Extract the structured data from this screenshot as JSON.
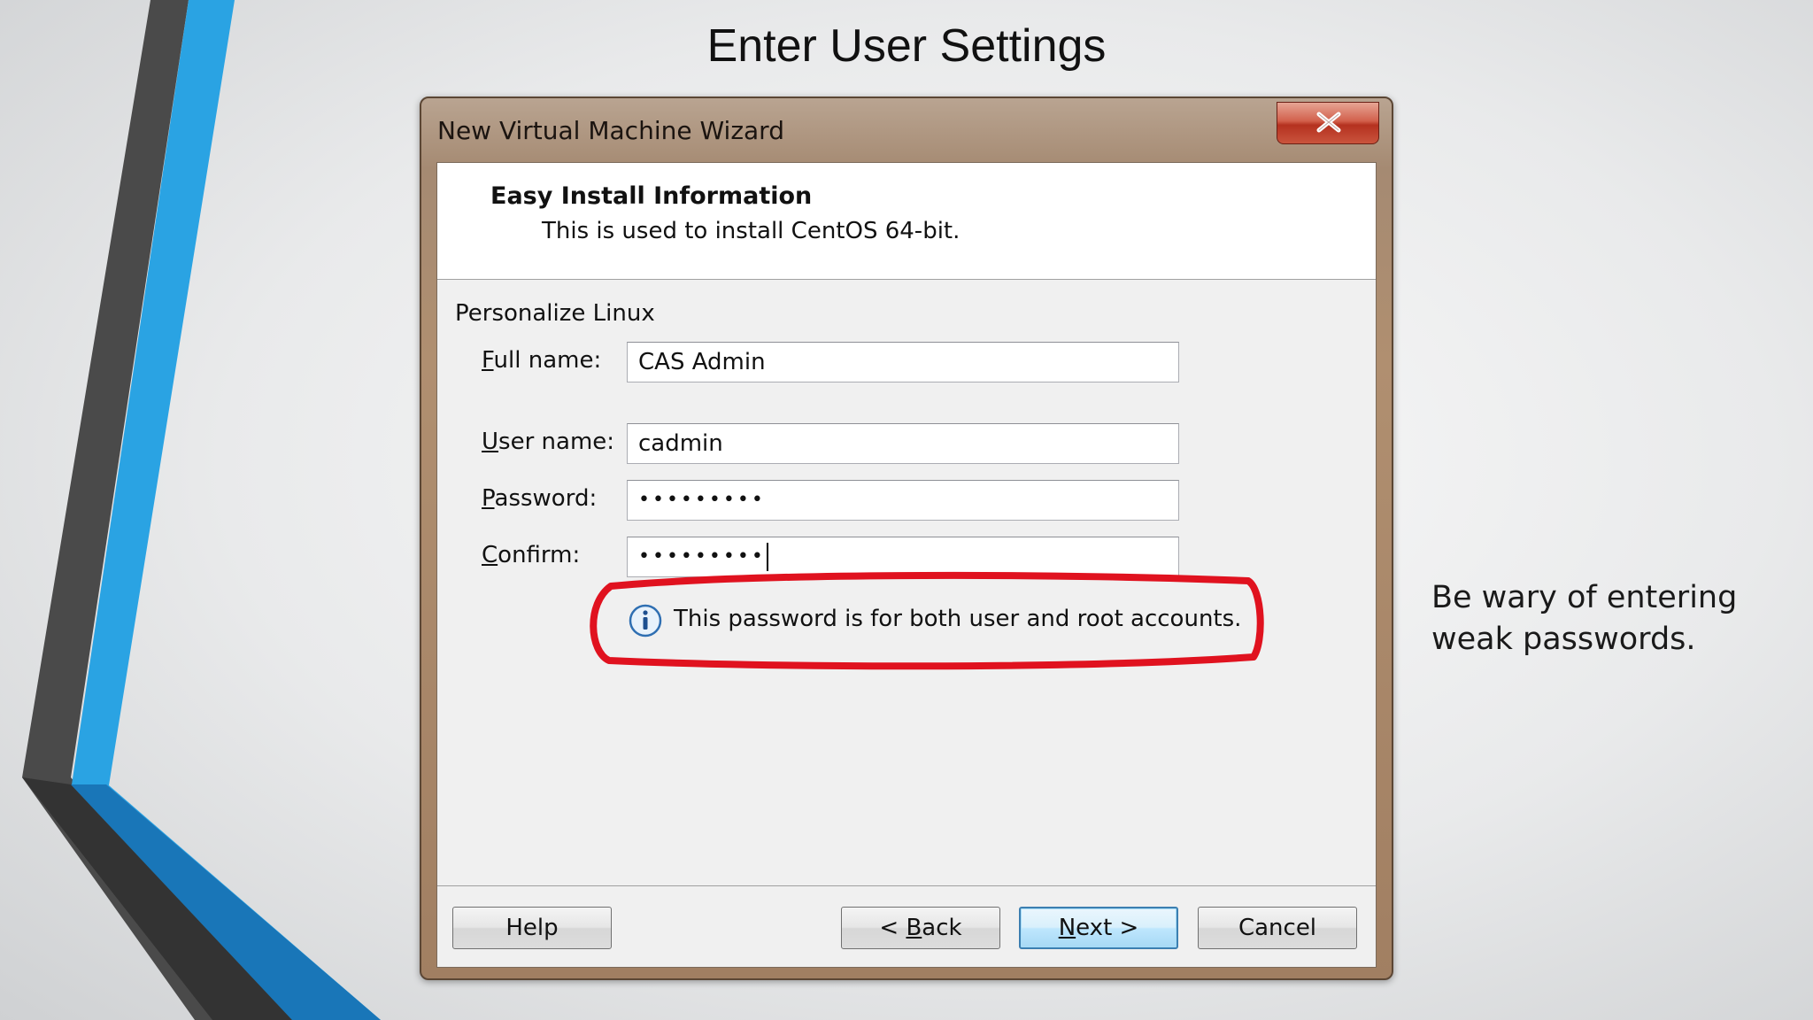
{
  "slide": {
    "title": "Enter User Settings",
    "note": "Be wary of entering weak passwords."
  },
  "window": {
    "title": "New Virtual Machine Wizard",
    "close_icon": "close-icon",
    "header": {
      "title": "Easy Install Information",
      "subtitle": "This is used to install CentOS 64-bit."
    },
    "group_label": "Personalize Linux",
    "fields": {
      "full_name": {
        "label_accel": "F",
        "label_rest": "ull name:",
        "value": "CAS Admin"
      },
      "user_name": {
        "label_accel": "U",
        "label_rest": "ser name:",
        "value": "cadmin"
      },
      "password": {
        "label_accel": "P",
        "label_rest": "assword:",
        "masked": "•••••••••"
      },
      "confirm": {
        "label_accel": "C",
        "label_rest": "onfirm:",
        "masked": "•••••••••"
      }
    },
    "info": {
      "icon": "info-icon",
      "text": "This password is for both user and root accounts."
    },
    "buttons": {
      "help": "Help",
      "back_pre": "< ",
      "back_accel": "B",
      "back_rest": "ack",
      "next_accel": "N",
      "next_rest": "ext >",
      "cancel": "Cancel"
    }
  },
  "colors": {
    "accent_blue": "#29a8e8",
    "dark_stripe": "#3a3a3a",
    "annotation_red": "#e0121f"
  }
}
